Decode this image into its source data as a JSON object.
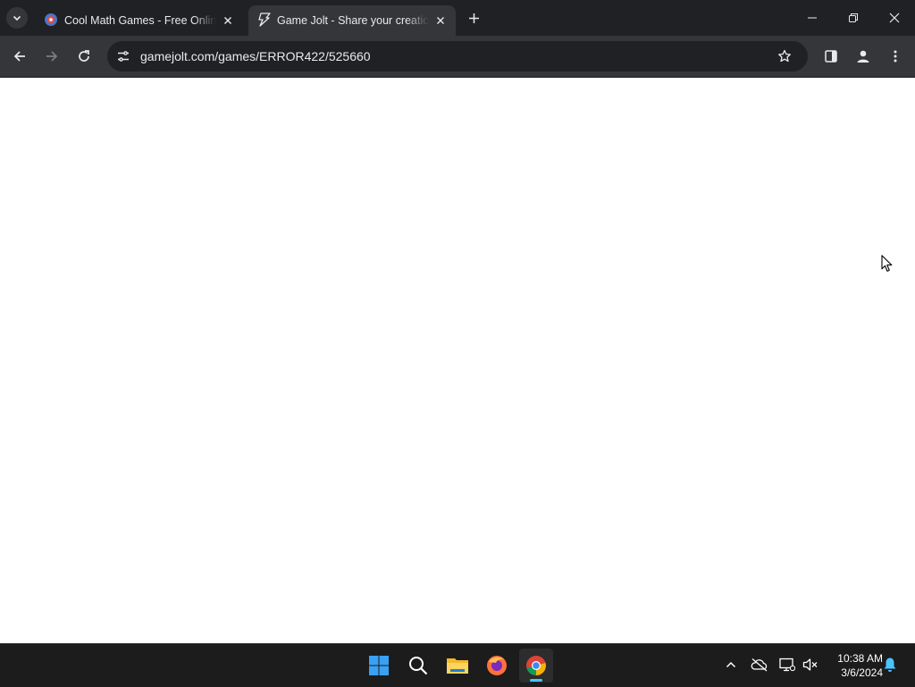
{
  "browser": {
    "tabs": [
      {
        "title": "Cool Math Games - Free Online Games",
        "icon": "coolmath-favicon",
        "active": false
      },
      {
        "title": "Game Jolt - Share your creations",
        "icon": "gamejolt-favicon",
        "active": true
      }
    ],
    "address_bar": {
      "url": "gamejolt.com/games/ERROR422/525660"
    }
  },
  "page": {
    "content": ""
  },
  "taskbar": {
    "apps": [
      "windows-start",
      "search",
      "file-explorer",
      "firefox",
      "chrome"
    ],
    "active_app": "chrome",
    "clock": {
      "time": "10:38 AM",
      "date": "3/6/2024"
    }
  },
  "colors": {
    "tabstrip": "#202124",
    "toolbar": "#35363a",
    "omnibox": "#202124",
    "taskbar": "#1c1c1c",
    "accent": "#4cc2ff"
  }
}
